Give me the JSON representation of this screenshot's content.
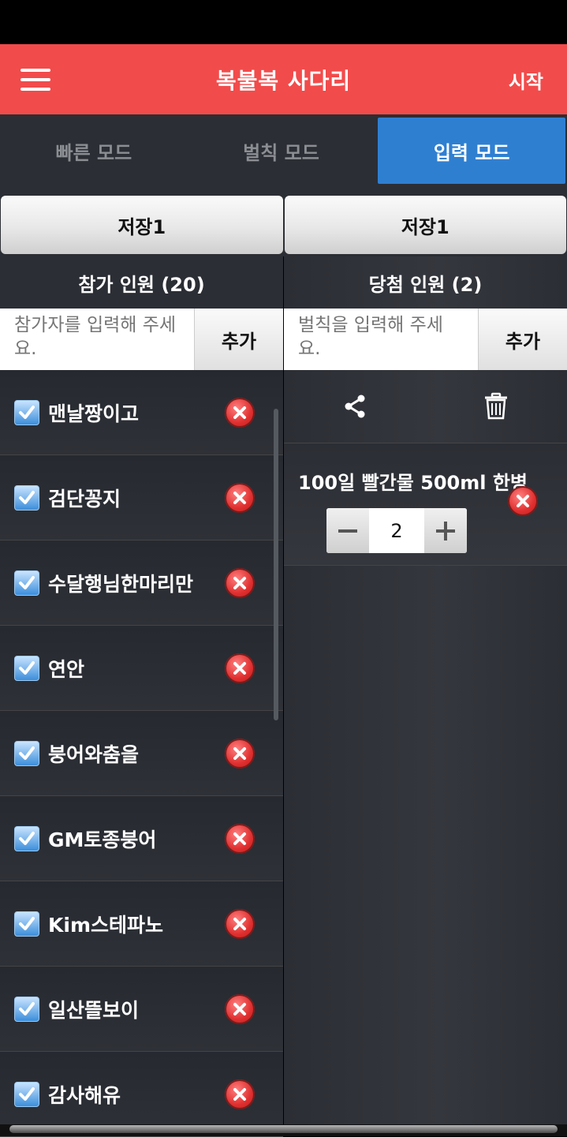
{
  "app": {
    "title": "복불복 사다리",
    "start_label": "시작"
  },
  "mode_tabs": [
    {
      "label": "빠른 모드",
      "active": false
    },
    {
      "label": "벌칙 모드",
      "active": false
    },
    {
      "label": "입력 모드",
      "active": true
    }
  ],
  "save_buttons": {
    "left_label": "저장1",
    "right_label": "저장1"
  },
  "participants": {
    "header": "참가 인원 (20)",
    "placeholder": "참가자를 입력해 주세요.",
    "add_label": "추가",
    "items": [
      {
        "name": "맨날짱이고",
        "checked": true
      },
      {
        "name": "검단꽁지",
        "checked": true
      },
      {
        "name": "수달행님한마리만",
        "checked": true
      },
      {
        "name": "연안",
        "checked": true
      },
      {
        "name": "붕어와춤을",
        "checked": true
      },
      {
        "name": "GM토종붕어",
        "checked": true
      },
      {
        "name": "Kim스테파노",
        "checked": true
      },
      {
        "name": "일산뜰보이",
        "checked": true
      },
      {
        "name": "감사해유",
        "checked": true
      }
    ]
  },
  "winners": {
    "header": "당첨 인원 (2)",
    "placeholder": "벌칙을 입력해 주세요.",
    "add_label": "추가",
    "items": [
      {
        "label": "100일 빨간물 500ml 한병",
        "count": "2"
      }
    ]
  },
  "icons": {
    "menu": "hamburger-menu-icon",
    "share": "share-icon",
    "trash": "trash-icon",
    "delete": "close-circle-icon",
    "check": "checkmark-icon",
    "minus": "minus-icon",
    "plus": "plus-icon"
  },
  "colors": {
    "app_bar": "#f24b4b",
    "active_tab": "#2f7fd1",
    "background": "#2b2e34",
    "delete": "#e03030"
  }
}
